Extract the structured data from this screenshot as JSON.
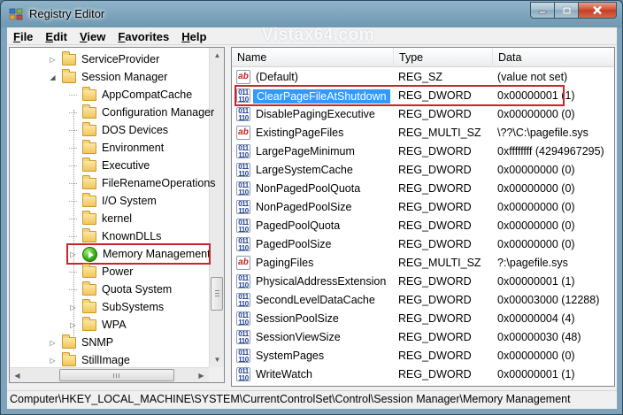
{
  "window": {
    "title": "Registry Editor",
    "caption_buttons": {
      "minimize": "—",
      "maximize": "□",
      "close": "✕"
    }
  },
  "menu": [
    "File",
    "Edit",
    "View",
    "Favorites",
    "Help"
  ],
  "watermark": "Vistax64.com",
  "tree": {
    "items": [
      {
        "label": "ServiceProvider",
        "level": 0,
        "expander": "collapsed",
        "icon": "folder-icon"
      },
      {
        "label": "Session Manager",
        "level": 0,
        "expander": "expanded",
        "icon": "folder-icon"
      },
      {
        "label": "AppCompatCache",
        "level": 1,
        "expander": "none",
        "icon": "folder-icon"
      },
      {
        "label": "Configuration Manager",
        "level": 1,
        "expander": "none",
        "icon": "folder-icon"
      },
      {
        "label": "DOS Devices",
        "level": 1,
        "expander": "none",
        "icon": "folder-icon"
      },
      {
        "label": "Environment",
        "level": 1,
        "expander": "none",
        "icon": "folder-icon"
      },
      {
        "label": "Executive",
        "level": 1,
        "expander": "none",
        "icon": "folder-icon"
      },
      {
        "label": "FileRenameOperations",
        "level": 1,
        "expander": "none",
        "icon": "folder-icon"
      },
      {
        "label": "I/O System",
        "level": 1,
        "expander": "none",
        "icon": "folder-icon"
      },
      {
        "label": "kernel",
        "level": 1,
        "expander": "none",
        "icon": "folder-icon"
      },
      {
        "label": "KnownDLLs",
        "level": 1,
        "expander": "none",
        "icon": "folder-icon"
      },
      {
        "label": "Memory Management",
        "level": 1,
        "expander": "collapsed",
        "icon": "go-icon"
      },
      {
        "label": "Power",
        "level": 1,
        "expander": "none",
        "icon": "folder-icon"
      },
      {
        "label": "Quota System",
        "level": 1,
        "expander": "none",
        "icon": "folder-icon"
      },
      {
        "label": "SubSystems",
        "level": 1,
        "expander": "collapsed",
        "icon": "folder-icon"
      },
      {
        "label": "WPA",
        "level": 1,
        "expander": "collapsed",
        "icon": "folder-icon"
      },
      {
        "label": "SNMP",
        "level": 0,
        "expander": "collapsed",
        "icon": "folder-icon"
      },
      {
        "label": "StillImage",
        "level": 0,
        "expander": "collapsed",
        "icon": "folder-icon"
      }
    ]
  },
  "list": {
    "columns": [
      "Name",
      "Type",
      "Data"
    ],
    "rows": [
      {
        "name": "(Default)",
        "type": "REG_SZ",
        "data": "(value not set)",
        "icon": "string-value-icon"
      },
      {
        "name": "ClearPageFileAtShutdown",
        "type": "REG_DWORD",
        "data": "0x00000001 (1)",
        "icon": "dword-value-icon"
      },
      {
        "name": "DisablePagingExecutive",
        "type": "REG_DWORD",
        "data": "0x00000000 (0)",
        "icon": "dword-value-icon"
      },
      {
        "name": "ExistingPageFiles",
        "type": "REG_MULTI_SZ",
        "data": "\\??\\C:\\pagefile.sys",
        "icon": "string-value-icon"
      },
      {
        "name": "LargePageMinimum",
        "type": "REG_DWORD",
        "data": "0xffffffff (4294967295)",
        "icon": "dword-value-icon"
      },
      {
        "name": "LargeSystemCache",
        "type": "REG_DWORD",
        "data": "0x00000000 (0)",
        "icon": "dword-value-icon"
      },
      {
        "name": "NonPagedPoolQuota",
        "type": "REG_DWORD",
        "data": "0x00000000 (0)",
        "icon": "dword-value-icon"
      },
      {
        "name": "NonPagedPoolSize",
        "type": "REG_DWORD",
        "data": "0x00000000 (0)",
        "icon": "dword-value-icon"
      },
      {
        "name": "PagedPoolQuota",
        "type": "REG_DWORD",
        "data": "0x00000000 (0)",
        "icon": "dword-value-icon"
      },
      {
        "name": "PagedPoolSize",
        "type": "REG_DWORD",
        "data": "0x00000000 (0)",
        "icon": "dword-value-icon"
      },
      {
        "name": "PagingFiles",
        "type": "REG_MULTI_SZ",
        "data": "?:\\pagefile.sys",
        "icon": "string-value-icon"
      },
      {
        "name": "PhysicalAddressExtension",
        "type": "REG_DWORD",
        "data": "0x00000001 (1)",
        "icon": "dword-value-icon"
      },
      {
        "name": "SecondLevelDataCache",
        "type": "REG_DWORD",
        "data": "0x00003000 (12288)",
        "icon": "dword-value-icon"
      },
      {
        "name": "SessionPoolSize",
        "type": "REG_DWORD",
        "data": "0x00000004 (4)",
        "icon": "dword-value-icon"
      },
      {
        "name": "SessionViewSize",
        "type": "REG_DWORD",
        "data": "0x00000030 (48)",
        "icon": "dword-value-icon"
      },
      {
        "name": "SystemPages",
        "type": "REG_DWORD",
        "data": "0x00000000 (0)",
        "icon": "dword-value-icon"
      },
      {
        "name": "WriteWatch",
        "type": "REG_DWORD",
        "data": "0x00000001 (1)",
        "icon": "dword-value-icon"
      }
    ]
  },
  "icon_text": {
    "string": "ab",
    "dword": "011\n110"
  },
  "statusbar": "Computer\\HKEY_LOCAL_MACHINE\\SYSTEM\\CurrentControlSet\\Control\\Session Manager\\Memory Management",
  "colors": {
    "selection": "#3399ff",
    "highlight_box": "#c8242b"
  }
}
